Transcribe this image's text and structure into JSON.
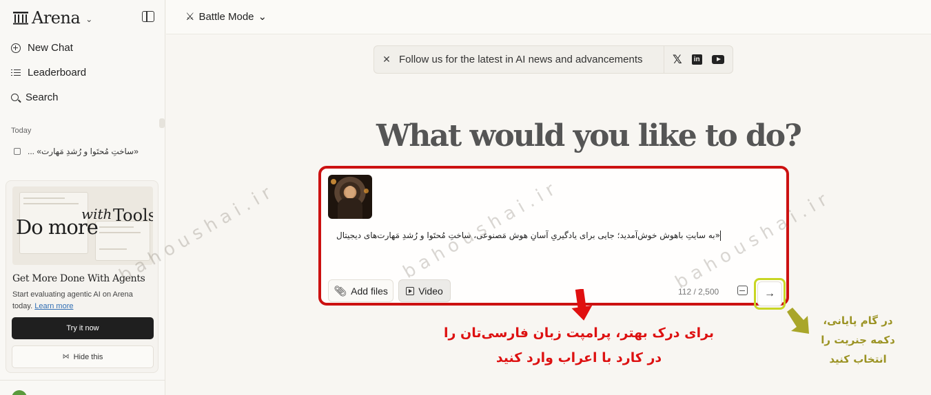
{
  "sidebar": {
    "brand": "Arena",
    "nav": [
      {
        "label": "New Chat",
        "icon": "plus-circle-icon"
      },
      {
        "label": "Leaderboard",
        "icon": "list-icon"
      },
      {
        "label": "Search",
        "icon": "search-icon"
      }
    ],
    "section_today": "Today",
    "chat_item": "«ساختِ مُحتَوا و رُشدِ مَهارت» ...",
    "promo": {
      "image_do_more": "Do more",
      "image_with": "with",
      "image_tools": "Tools",
      "title": "Get More Done With Agents",
      "desc": "Start evaluating agentic AI on Arena today.",
      "link": "Learn more",
      "try_label": "Try it now",
      "hide_label": "Hide this"
    }
  },
  "topbar": {
    "mode_label": "Battle Mode"
  },
  "banner": {
    "text": "Follow us for the latest in AI news and advancements"
  },
  "main": {
    "headline": "What would you like to do?",
    "prompt_text": "«به سایتِ باهوش خوش‌آمدید؛ جایی برای یادگیریِ آسانِ هوشِ مَصنوعی، ساختِ مُحتَوا و رُشدِ مَهارت‌های دیجیتال»",
    "add_files_label": "Add files",
    "video_label": "Video",
    "char_count": "112 / 2,500"
  },
  "annotations": {
    "red_line1": "برای درک بهتر، پرامپت زبان فارسی‌تان را",
    "red_line2": "در کارد با اعراب وارد کنید",
    "olive_line1": "در گام پایانی،",
    "olive_line2": "دکمه جنریت را",
    "olive_line3": "انتخاب کنید",
    "watermark": "bahoushai.ir"
  },
  "colors": {
    "annotation_red": "#cc1111",
    "annotation_olive": "#c8d624",
    "background": "#f8f6f2"
  }
}
